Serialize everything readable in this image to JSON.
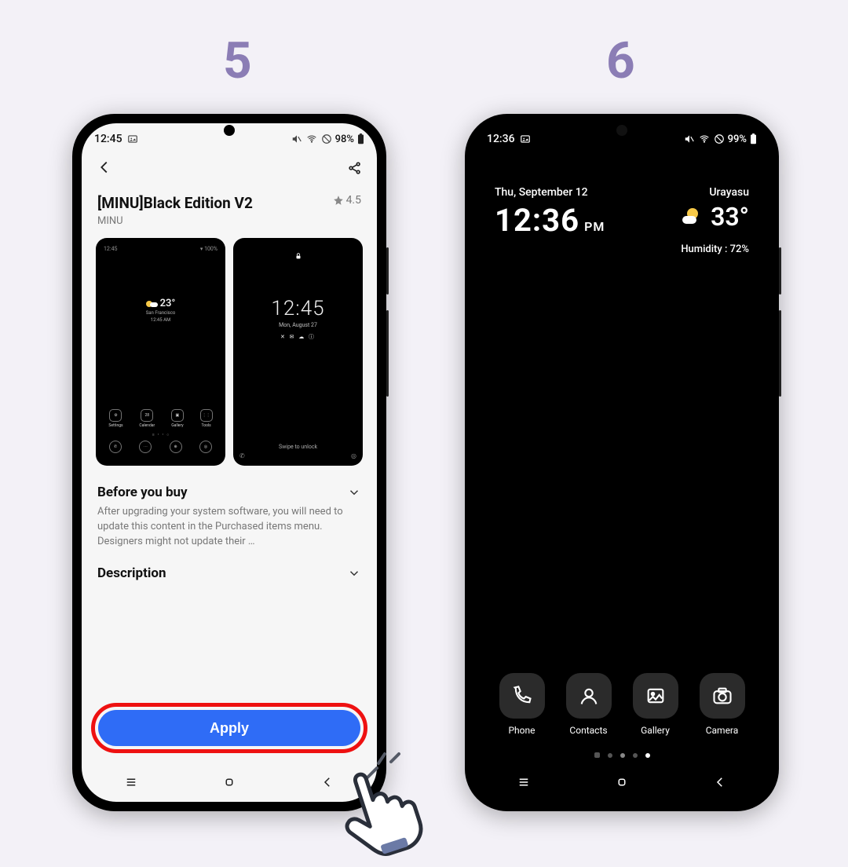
{
  "steps": {
    "five": "5",
    "six": "6"
  },
  "left": {
    "status": {
      "time": "12:45",
      "battery": "98%"
    },
    "theme": {
      "title": "[MINU]Black Edition V2",
      "author": "MINU",
      "rating": "4.5"
    },
    "preview1": {
      "temp": "23°",
      "city": "San Francisco",
      "clock": "12:45 AM",
      "apps": [
        "Settings",
        "Calendar",
        "Gallery",
        "Tools"
      ]
    },
    "preview2": {
      "time": "12:45",
      "date": "Mon, August 27",
      "swipe": "Swipe to unlock"
    },
    "before_head": "Before you buy",
    "before_body": "After upgrading your system software, you will need to update this content in the Purchased items menu. Designers might not update their …",
    "desc_head": "Description",
    "apply": "Apply"
  },
  "right": {
    "status": {
      "time": "12:36",
      "battery": "99%"
    },
    "date": "Thu, September 12",
    "time": "12:36",
    "ampm": "PM",
    "city": "Urayasu",
    "temp": "33°",
    "humidity": "Humidity : 72%",
    "dock": [
      "Phone",
      "Contacts",
      "Gallery",
      "Camera"
    ]
  }
}
